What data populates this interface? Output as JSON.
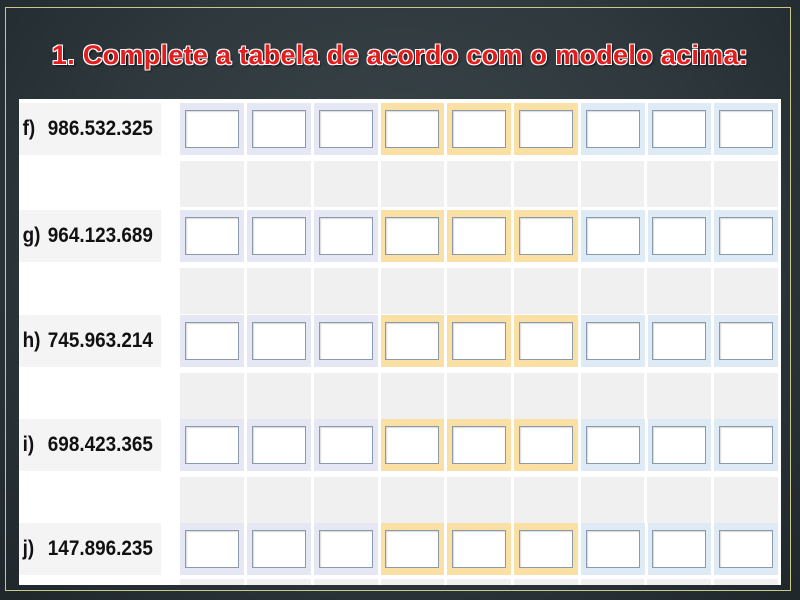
{
  "title": "1. Complete a tabela de acordo com o modelo acima:",
  "rows": [
    {
      "letter": "f)",
      "number": "986.532.325"
    },
    {
      "letter": "g)",
      "number": "964.123.689"
    },
    {
      "letter": "h)",
      "number": "745.963.214"
    },
    {
      "letter": "i)",
      "number": "698.423.365"
    },
    {
      "letter": "j)",
      "number": "147.896.235"
    }
  ],
  "colors": {
    "title": "#e11d1d",
    "group_millions": "#e5e7f5",
    "group_thousands": "#fae0a5",
    "group_units": "#deeaf6"
  }
}
